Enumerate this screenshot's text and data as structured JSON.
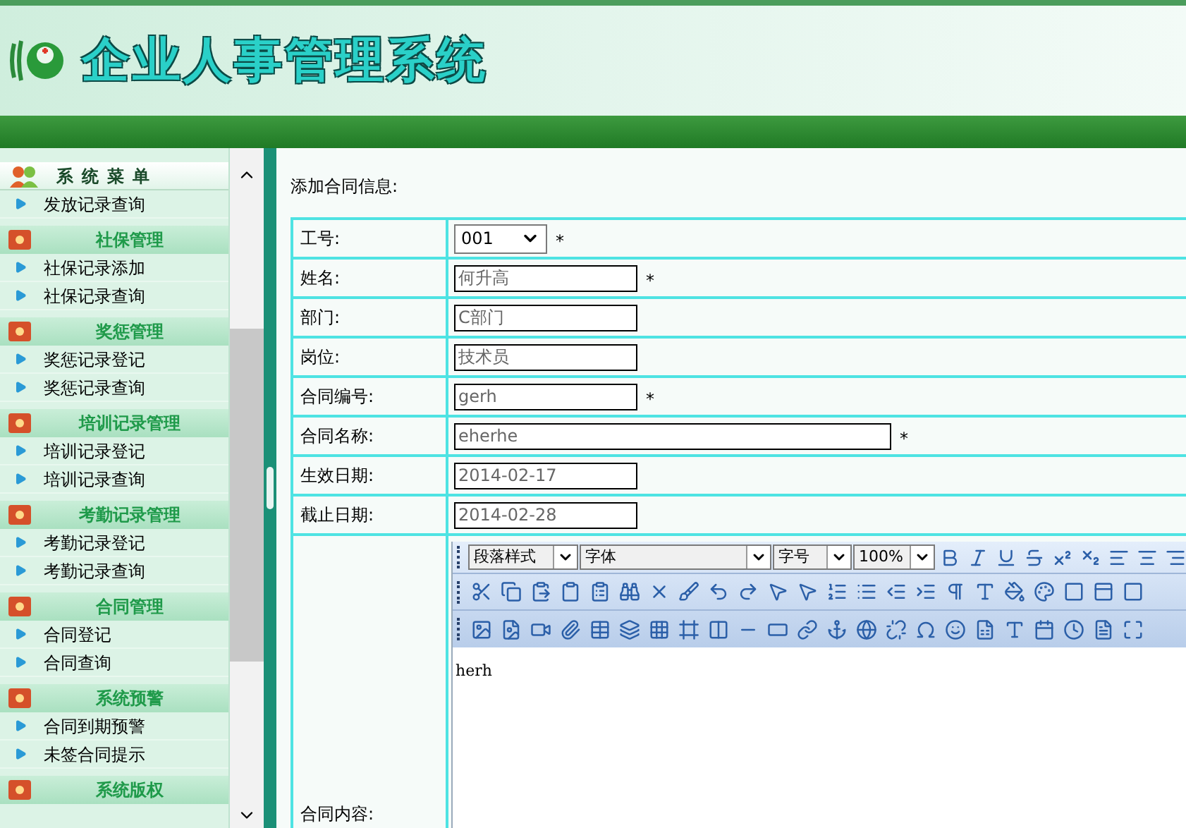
{
  "header": {
    "title": "企业人事管理系统"
  },
  "sidebar": {
    "title": "系统菜单",
    "items": [
      {
        "kind": "link",
        "label": "发放记录查询"
      },
      {
        "kind": "heading",
        "label": "社保管理"
      },
      {
        "kind": "link",
        "label": "社保记录添加"
      },
      {
        "kind": "link",
        "label": "社保记录查询"
      },
      {
        "kind": "heading",
        "label": "奖惩管理"
      },
      {
        "kind": "link",
        "label": "奖惩记录登记"
      },
      {
        "kind": "link",
        "label": "奖惩记录查询"
      },
      {
        "kind": "heading",
        "label": "培训记录管理"
      },
      {
        "kind": "link",
        "label": "培训记录登记"
      },
      {
        "kind": "link",
        "label": "培训记录查询"
      },
      {
        "kind": "heading",
        "label": "考勤记录管理"
      },
      {
        "kind": "link",
        "label": "考勤记录登记"
      },
      {
        "kind": "link",
        "label": "考勤记录查询"
      },
      {
        "kind": "heading",
        "label": "合同管理"
      },
      {
        "kind": "link",
        "label": "合同登记"
      },
      {
        "kind": "link",
        "label": "合同查询"
      },
      {
        "kind": "heading",
        "label": "系统预警"
      },
      {
        "kind": "link",
        "label": "合同到期预警"
      },
      {
        "kind": "link",
        "label": "未签合同提示"
      },
      {
        "kind": "heading",
        "label": "系统版权"
      }
    ]
  },
  "form": {
    "title": "添加合同信息:",
    "fields": [
      {
        "label": "工号:",
        "kind": "select",
        "value": "001",
        "required_mark": "*"
      },
      {
        "label": "姓名:",
        "kind": "text",
        "value": "何升高",
        "required_mark": "*"
      },
      {
        "label": "部门:",
        "kind": "text",
        "value": "C部门"
      },
      {
        "label": "岗位:",
        "kind": "text",
        "value": "技术员"
      },
      {
        "label": "合同编号:",
        "kind": "text",
        "value": "gerh",
        "required_mark": "*"
      },
      {
        "label": "合同名称:",
        "kind": "long_text",
        "value": "eherhe",
        "required_mark": "*"
      },
      {
        "label": "生效日期:",
        "kind": "text",
        "value": "2014-02-17"
      },
      {
        "label": "截止日期:",
        "kind": "text",
        "value": "2014-02-28"
      }
    ],
    "editor": {
      "label": "合同内容:",
      "dropdowns": [
        "段落样式",
        "字体",
        "字号",
        "100%"
      ],
      "content": "herh"
    }
  }
}
